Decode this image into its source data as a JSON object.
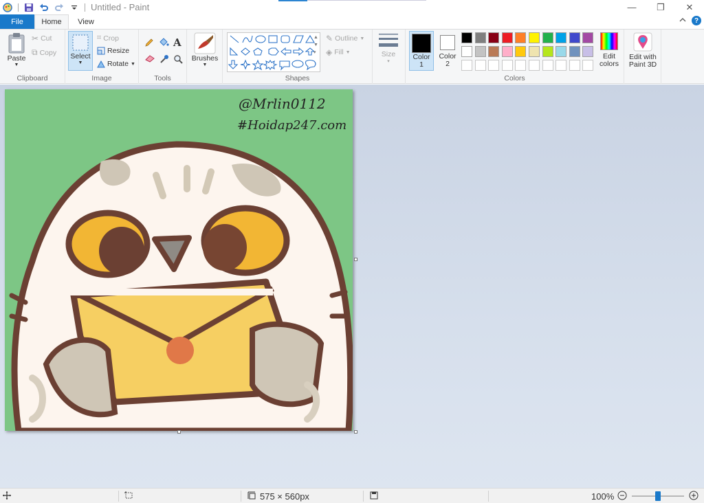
{
  "window": {
    "title": "Untitled - Paint",
    "controls": {
      "minimize": "—",
      "restore": "❐",
      "close": "✕"
    }
  },
  "tabs": {
    "file": "File",
    "home": "Home",
    "view": "View"
  },
  "ribbon": {
    "clipboard": {
      "label": "Clipboard",
      "paste": "Paste",
      "cut": "Cut",
      "copy": "Copy"
    },
    "image": {
      "label": "Image",
      "select": "Select",
      "crop": "Crop",
      "resize": "Resize",
      "rotate": "Rotate"
    },
    "tools": {
      "label": "Tools"
    },
    "brushes": {
      "label": "Brushes"
    },
    "shapes": {
      "label": "Shapes",
      "outline": "Outline",
      "fill": "Fill"
    },
    "size": {
      "label": "Size"
    },
    "colors": {
      "label": "Colors",
      "color1": "Color",
      "color1_num": "1",
      "color2": "Color",
      "color2_num": "2",
      "edit_colors_1": "Edit",
      "edit_colors_2": "colors",
      "color1_value": "#000000",
      "color2_value": "#ffffff",
      "palette_row1": [
        "#000000",
        "#7f7f7f",
        "#880015",
        "#ed1c24",
        "#ff7f27",
        "#fff200",
        "#22b14c",
        "#00a2e8",
        "#3f48cc",
        "#a349a4"
      ],
      "palette_row2": [
        "#ffffff",
        "#c3c3c3",
        "#b97a57",
        "#ffaec9",
        "#ffc90e",
        "#efe4b0",
        "#b5e61d",
        "#99d9ea",
        "#7092be",
        "#c8bfe7"
      ]
    },
    "paint3d": {
      "line1": "Edit with",
      "line2": "Paint 3D"
    }
  },
  "canvas": {
    "watermark1": "@Mrlin0112",
    "watermark2": "#Hoidap247.com",
    "background": "#7dc685"
  },
  "status": {
    "dimensions": "575 × 560px",
    "zoom": "100%",
    "zoom_level": 0.5
  }
}
